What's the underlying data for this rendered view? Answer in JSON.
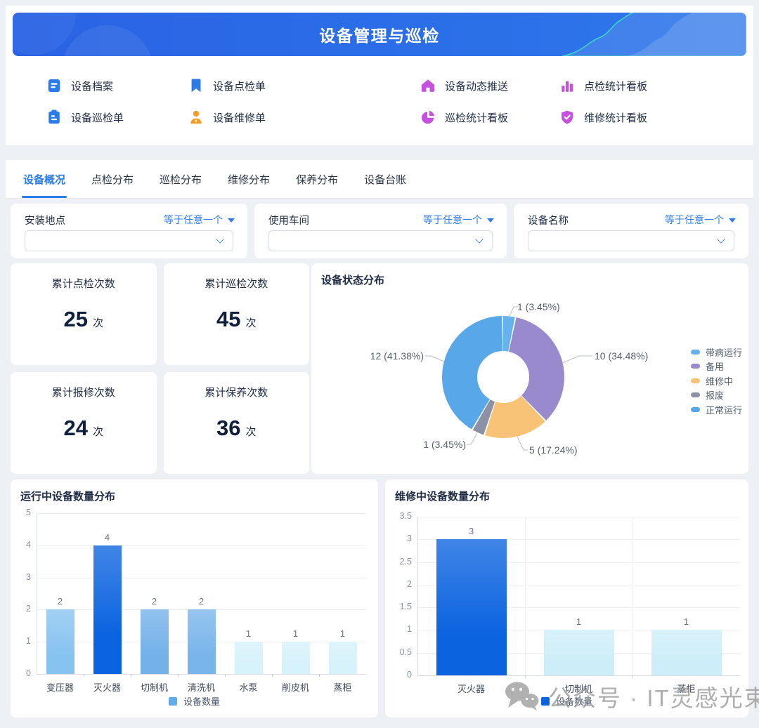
{
  "banner": {
    "title": "设备管理与巡检"
  },
  "quick_menu": {
    "items": [
      {
        "label": "设备档案",
        "icon": "document-icon",
        "color": "#2b7ce9"
      },
      {
        "label": "设备点检单",
        "icon": "bookmark-icon",
        "color": "#2b7ce9"
      },
      {
        "label": "设备动态推送",
        "icon": "home-icon",
        "color": "#c650e0"
      },
      {
        "label": "点检统计看板",
        "icon": "bar-chart-icon",
        "color": "#c650e0"
      },
      {
        "label": "设备巡检单",
        "icon": "clipboard-icon",
        "color": "#2b7ce9"
      },
      {
        "label": "设备维修单",
        "icon": "person-icon",
        "color": "#f59a23"
      },
      {
        "label": "巡检统计看板",
        "icon": "pie-chart-icon",
        "color": "#c650e0"
      },
      {
        "label": "维修统计看板",
        "icon": "shield-check-icon",
        "color": "#c650e0"
      }
    ]
  },
  "tabs": {
    "active_index": 0,
    "items": [
      "设备概况",
      "点检分布",
      "巡检分布",
      "维修分布",
      "保养分布",
      "设备台账"
    ]
  },
  "filters": [
    {
      "label": "安装地点",
      "operator": "等于任意一个",
      "value": ""
    },
    {
      "label": "使用车间",
      "operator": "等于任意一个",
      "value": ""
    },
    {
      "label": "设备名称",
      "operator": "等于任意一个",
      "value": ""
    }
  ],
  "stat_cards": [
    {
      "title": "累计点检次数",
      "value": "25",
      "unit": "次"
    },
    {
      "title": "累计巡检次数",
      "value": "45",
      "unit": "次"
    },
    {
      "title": "累计报修次数",
      "value": "24",
      "unit": "次"
    },
    {
      "title": "累计保养次数",
      "value": "36",
      "unit": "次"
    }
  ],
  "chart_data": [
    {
      "type": "pie",
      "title": "设备状态分布",
      "labels": [
        "带病运行",
        "备用",
        "维修中",
        "报废",
        "正常运行"
      ],
      "values": [
        1,
        10,
        5,
        1,
        12
      ],
      "percents": [
        "3.45%",
        "34.48%",
        "17.24%",
        "3.45%",
        "41.38%"
      ],
      "colors": [
        "#66b2ee",
        "#998ace",
        "#f8c376",
        "#8d91a5",
        "#57a7e9"
      ],
      "callouts": [
        "1 (3.45%)",
        "10 (34.48%)",
        "5 (17.24%)",
        "1 (3.45%)",
        "12 (41.38%)"
      ],
      "donut": true,
      "legend_position": "right"
    },
    {
      "type": "bar",
      "title": "运行中设备数量分布",
      "categories": [
        "变压器",
        "灭火器",
        "切制机",
        "清洗机",
        "水泵",
        "削皮机",
        "蒸柜"
      ],
      "values": [
        2,
        4,
        2,
        2,
        1,
        1,
        1
      ],
      "bar_colors": [
        "#87c3f0",
        "#0b63e0",
        "#74b1e9",
        "#79b5eb",
        "#d6f2fb",
        "#d6f2fb",
        "#d6f2fb"
      ],
      "ylim": [
        0,
        5
      ],
      "yticks": [
        0,
        1,
        2,
        3,
        4,
        5
      ],
      "legend": "设备数量",
      "legend_color": "#63aae8",
      "grid": true
    },
    {
      "type": "bar",
      "title": "维修中设备数量分布",
      "categories": [
        "灭火器",
        "切制机",
        "蒸柜"
      ],
      "values": [
        3,
        1,
        1
      ],
      "bar_colors": [
        "#0b63e0",
        "#cdeef8",
        "#cdeef8"
      ],
      "ylim": [
        0,
        3.5
      ],
      "yticks": [
        0,
        0.5,
        1,
        1.5,
        2,
        2.5,
        3,
        3.5
      ],
      "legend": "设备数量",
      "legend_color": "#0b63e0",
      "grid": true
    }
  ],
  "watermark": {
    "text": "公众号 · IT灵感光束",
    "icon": "wechat-icon"
  }
}
